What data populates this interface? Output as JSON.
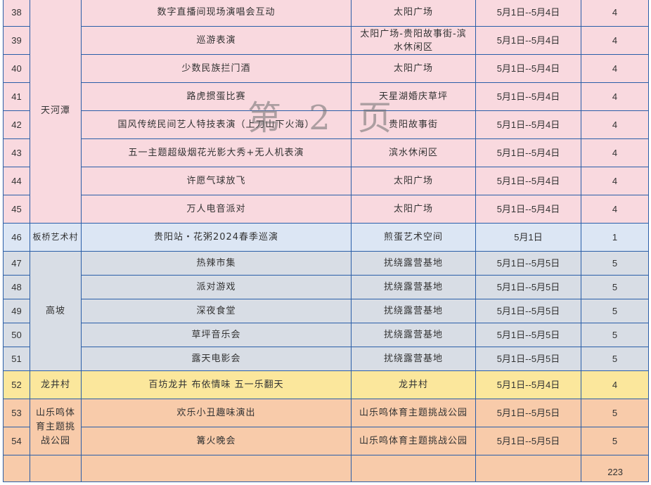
{
  "rows": [
    {
      "no": "38",
      "event": "数字直播间现场演唱会互动",
      "venue": "太阳广场",
      "date": "5月1日--5月4日",
      "days": "4"
    },
    {
      "no": "39",
      "event": "巡游表演",
      "venue": "太阳广场-贵阳故事街-滨水休闲区",
      "date": "5月1日--5月4日",
      "days": "4"
    },
    {
      "no": "40",
      "event": "少数民族拦门酒",
      "venue": "太阳广场",
      "date": "5月1日--5月4日",
      "days": "4"
    },
    {
      "no": "41",
      "event": "路虎掼蛋比赛",
      "venue": "天星湖婚庆草坪",
      "date": "5月1日--5月4日",
      "days": "4"
    },
    {
      "no": "42",
      "event": "国风传统民间艺人特技表演（上刀山下火海）",
      "venue": "贵阳故事街",
      "date": "5月1日--5月4日",
      "days": "4"
    },
    {
      "no": "43",
      "event": "五一主题超级烟花光影大秀+无人机表演",
      "venue": "滨水休闲区",
      "date": "5月1日--5月4日",
      "days": "4"
    },
    {
      "no": "44",
      "event": "许愿气球放飞",
      "venue": "太阳广场",
      "date": "5月1日--5月4日",
      "days": "4"
    },
    {
      "no": "45",
      "event": "万人电音派对",
      "venue": "太阳广场",
      "date": "5月1日--5月4日",
      "days": "4"
    },
    {
      "no": "46",
      "event": "贵阳站・花粥2024春季巡演",
      "venue": "煎蛋艺术空间",
      "date": "5月1日",
      "days": "1"
    },
    {
      "no": "47",
      "event": "热辣市集",
      "venue": "扰绕露营基地",
      "date": "5月1日--5月5日",
      "days": "5"
    },
    {
      "no": "48",
      "event": "派对游戏",
      "venue": "扰绕露营基地",
      "date": "5月1日--5月5日",
      "days": "5"
    },
    {
      "no": "49",
      "event": "深夜食堂",
      "venue": "扰绕露营基地",
      "date": "5月1日--5月5日",
      "days": "5"
    },
    {
      "no": "50",
      "event": "草坪音乐会",
      "venue": "扰绕露营基地",
      "date": "5月1日--5月5日",
      "days": "5"
    },
    {
      "no": "51",
      "event": "露天电影会",
      "venue": "扰绕露营基地",
      "date": "5月1日--5月5日",
      "days": "5"
    },
    {
      "no": "52",
      "event": "百坊龙井 布依情味 五一乐翻天",
      "venue": "龙井村",
      "date": "5月1日--5月4日",
      "days": "4"
    },
    {
      "no": "53",
      "event": "欢乐小丑趣味演出",
      "venue": "山乐鸣体育主题挑战公园",
      "date": "5月1日--5月5日",
      "days": "5"
    },
    {
      "no": "54",
      "event": "篝火晚会",
      "venue": "山乐鸣体育主题挑战公园",
      "date": "5月1日--5月5日",
      "days": "5"
    }
  ],
  "areas": {
    "tianhetan": "天河潭",
    "banqiao": "板桥艺术村",
    "gaopo": "高坡",
    "longjing": "龙井村",
    "shanleming": "山乐鸣体育主题挑战公园"
  },
  "page_number": "223",
  "watermark": "第 2 页",
  "colors": {
    "pink": "#f9d9df",
    "blue": "#dce6f4",
    "gray": "#d8dde5",
    "yellow": "#fbe79c",
    "orange": "#f8cbaa",
    "border": "#2a5ea8"
  }
}
